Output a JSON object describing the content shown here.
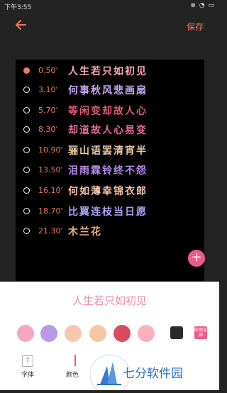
{
  "status_bar": {
    "time": "下午3:55",
    "icons": "⊗ ◔ ▭"
  },
  "toolbar": {
    "save_label": "保存"
  },
  "lyrics": [
    {
      "time": "0.50'",
      "text": "人生若只如初见",
      "color": "#f6a6bd",
      "active": true
    },
    {
      "time": "3.10'",
      "text": "何事秋风悲画扇",
      "color": "#c9a6f0",
      "active": false
    },
    {
      "time": "5.70'",
      "text": "等闲变却故人心",
      "color": "#e05878",
      "active": false
    },
    {
      "time": "8.30'",
      "text": "却道故人心易变",
      "color": "#e86aa0",
      "active": false
    },
    {
      "time": "10.90'",
      "text": "骊山语罢清宵半",
      "color": "#e8c7a0",
      "active": false
    },
    {
      "time": "13.50'",
      "text": "泪雨霖铃终不怨",
      "color": "#b58ae8",
      "active": false
    },
    {
      "time": "16.10'",
      "text": "何如薄幸锦衣郎",
      "color": "#f8c6a8",
      "active": false
    },
    {
      "time": "18.70'",
      "text": "比翼连枝当日愿",
      "color": "#a89ff0",
      "active": false
    },
    {
      "time": "21.30'",
      "text": "木兰花",
      "color": "#f0b27a",
      "active": false
    }
  ],
  "panel": {
    "preview_text": "人生若只如初见",
    "swatches": [
      "#f6a6c1",
      "#b79ae6",
      "#f9c7b0",
      "#f7c7a3",
      "#d84a62",
      "#fbb0c2"
    ],
    "apply_all_label": "应用全部",
    "tab_font_label": "字体",
    "tab_font_icon": "T",
    "tab_color_label": "颜色"
  },
  "watermark": {
    "text": "七分软件园"
  }
}
